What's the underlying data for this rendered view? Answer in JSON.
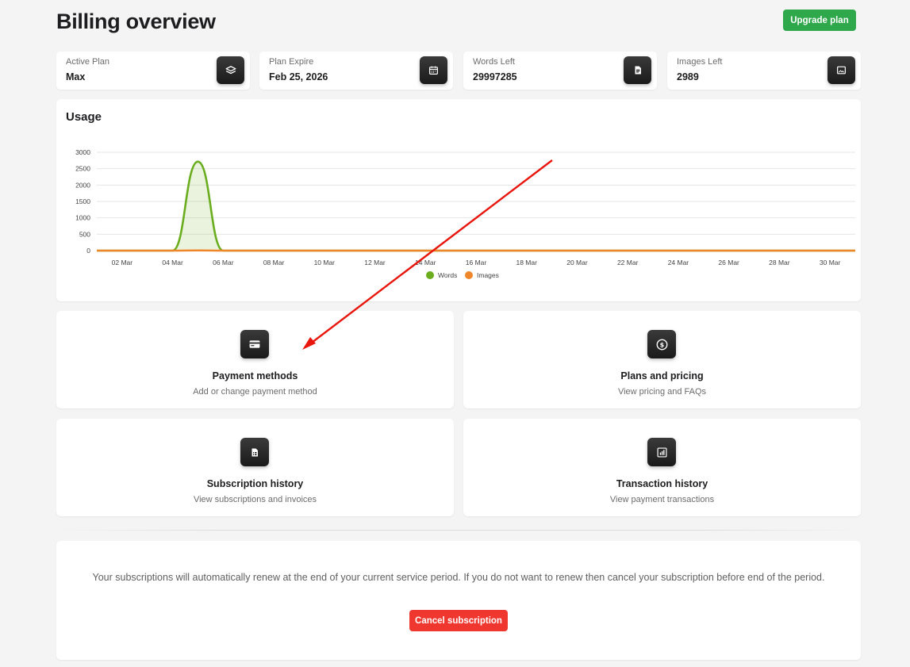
{
  "page": {
    "title": "Billing overview"
  },
  "header": {
    "upgrade_label": "Upgrade plan"
  },
  "stats": [
    {
      "label": "Active Plan",
      "value": "Max",
      "icon": "layers-icon"
    },
    {
      "label": "Plan Expire",
      "value": "Feb 25, 2026",
      "icon": "calendar-icon"
    },
    {
      "label": "Words Left",
      "value": "29997285",
      "icon": "document-icon"
    },
    {
      "label": "Images Left",
      "value": "2989",
      "icon": "image-icon"
    }
  ],
  "usage": {
    "title": "Usage"
  },
  "chart_data": {
    "type": "area",
    "title": "Usage",
    "x": [
      "01 Mar",
      "02 Mar",
      "03 Mar",
      "04 Mar",
      "05 Mar",
      "06 Mar",
      "07 Mar",
      "08 Mar",
      "09 Mar",
      "10 Mar",
      "11 Mar",
      "12 Mar",
      "13 Mar",
      "14 Mar",
      "15 Mar",
      "16 Mar",
      "17 Mar",
      "18 Mar",
      "19 Mar",
      "20 Mar",
      "21 Mar",
      "22 Mar",
      "23 Mar",
      "24 Mar",
      "25 Mar",
      "26 Mar",
      "27 Mar",
      "28 Mar",
      "29 Mar",
      "30 Mar",
      "31 Mar"
    ],
    "tick_labels": [
      "02 Mar",
      "04 Mar",
      "06 Mar",
      "08 Mar",
      "10 Mar",
      "12 Mar",
      "14 Mar",
      "16 Mar",
      "18 Mar",
      "20 Mar",
      "22 Mar",
      "24 Mar",
      "26 Mar",
      "28 Mar",
      "30 Mar"
    ],
    "y_ticks": [
      0,
      500,
      1000,
      1500,
      2000,
      2500,
      3000
    ],
    "ylim": [
      0,
      3000
    ],
    "series": [
      {
        "name": "Words",
        "color": "#6aad1e",
        "values": [
          0,
          0,
          0,
          0,
          2715,
          0,
          0,
          0,
          0,
          0,
          0,
          0,
          0,
          0,
          0,
          0,
          0,
          0,
          0,
          0,
          0,
          0,
          0,
          0,
          0,
          0,
          0,
          0,
          0,
          0,
          0
        ]
      },
      {
        "name": "Images",
        "color": "#f0862a",
        "values": [
          0,
          0,
          0,
          0,
          6,
          0,
          0,
          0,
          0,
          0,
          0,
          0,
          0,
          0,
          0,
          0,
          0,
          0,
          0,
          0,
          0,
          0,
          0,
          0,
          0,
          0,
          0,
          0,
          0,
          0,
          0
        ]
      }
    ],
    "legend": "bottom-center",
    "grid": true
  },
  "actions": [
    {
      "title": "Payment methods",
      "subtitle": "Add or change payment method",
      "icon": "credit-card-icon"
    },
    {
      "title": "Plans and pricing",
      "subtitle": "View pricing and FAQs",
      "icon": "dollar-coin-icon"
    },
    {
      "title": "Subscription history",
      "subtitle": "View subscriptions and invoices",
      "icon": "invoice-icon"
    },
    {
      "title": "Transaction history",
      "subtitle": "View payment transactions",
      "icon": "bar-chart-icon"
    }
  ],
  "renewal": {
    "text": "Your subscriptions will automatically renew at the end of your current service period. If you do not want to renew then cancel your subscription before end of the period.",
    "cancel_label": "Cancel subscription"
  },
  "annotation": {
    "color": "#e8160c"
  }
}
